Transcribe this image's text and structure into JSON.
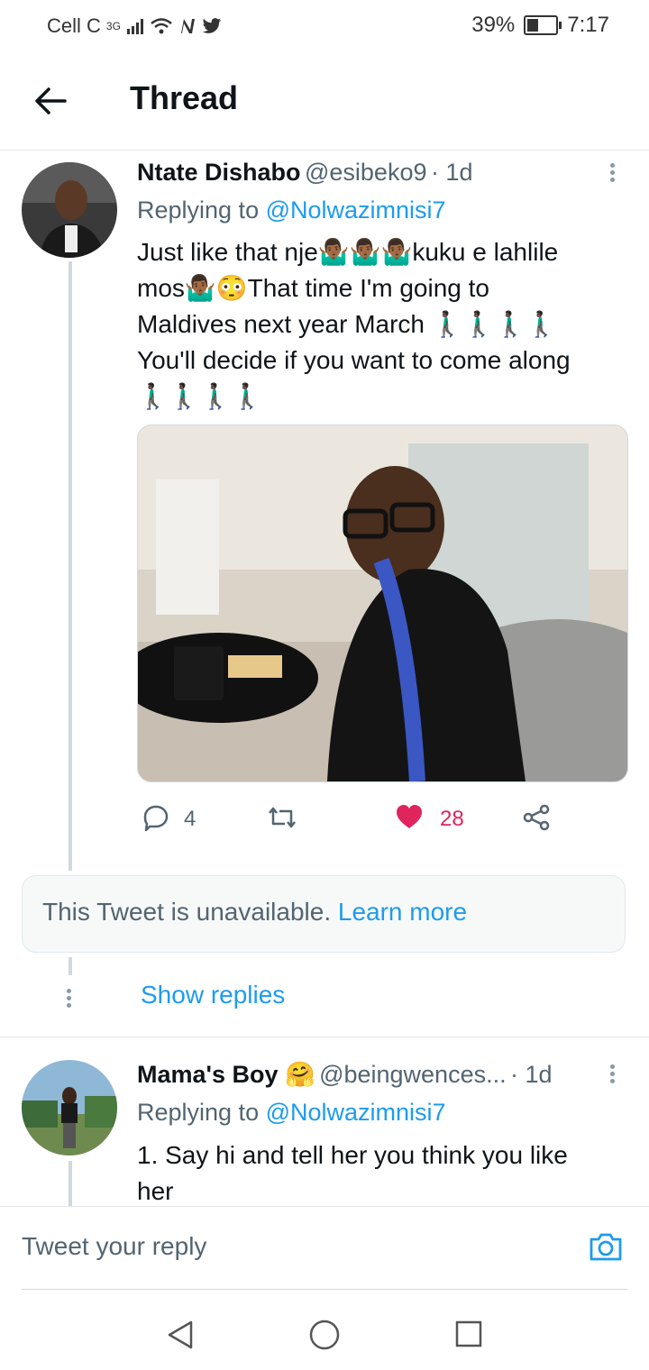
{
  "status_bar": {
    "carrier": "Cell C",
    "network": "3G",
    "battery": "39%",
    "battery_level": 0.39,
    "time": "7:17"
  },
  "header": {
    "title": "Thread",
    "back_icon": "arrow-left-icon"
  },
  "tweet1": {
    "name": "Ntate Dishabo",
    "handle": "@esibeko9",
    "time": "· 1d",
    "replying_prefix": "Replying to",
    "replying_to": "@Nolwazimnisi7",
    "line1": "Just like that nje🤷🏾‍♂️🤷🏾‍♂️🤷🏾‍♂️kuku e lahlile",
    "line2": "mos🤷🏾‍♂️😳That time I'm going to",
    "line3": "Maldives next year March 🚶🏿‍♂️🚶🏿‍♂️🚶🏿‍♂️🚶🏿‍♂️",
    "line4": "You'll decide if you want to come along",
    "line5": "🚶🏿‍♂️🚶🏿‍♂️🚶🏿‍♂️🚶🏿‍♂️",
    "replies": "4",
    "likes": "28",
    "like_color": "#e0245e"
  },
  "unavailable": {
    "text": "This Tweet is unavailable.",
    "link": "Learn more"
  },
  "show_replies": "Show replies",
  "tweet2": {
    "name": "Mama's Boy 🤗",
    "handle": "@beingwences...",
    "time": "· 1d",
    "replying_prefix": "Replying to",
    "replying_to": "@Nolwazimnisi7",
    "line1": "1. Say hi and tell her you think you like",
    "line2": "her"
  },
  "compose": {
    "placeholder": "Tweet your reply",
    "icon": "camera-icon"
  },
  "colors": {
    "accent": "#1d9bf0",
    "like": "#e0245e"
  }
}
